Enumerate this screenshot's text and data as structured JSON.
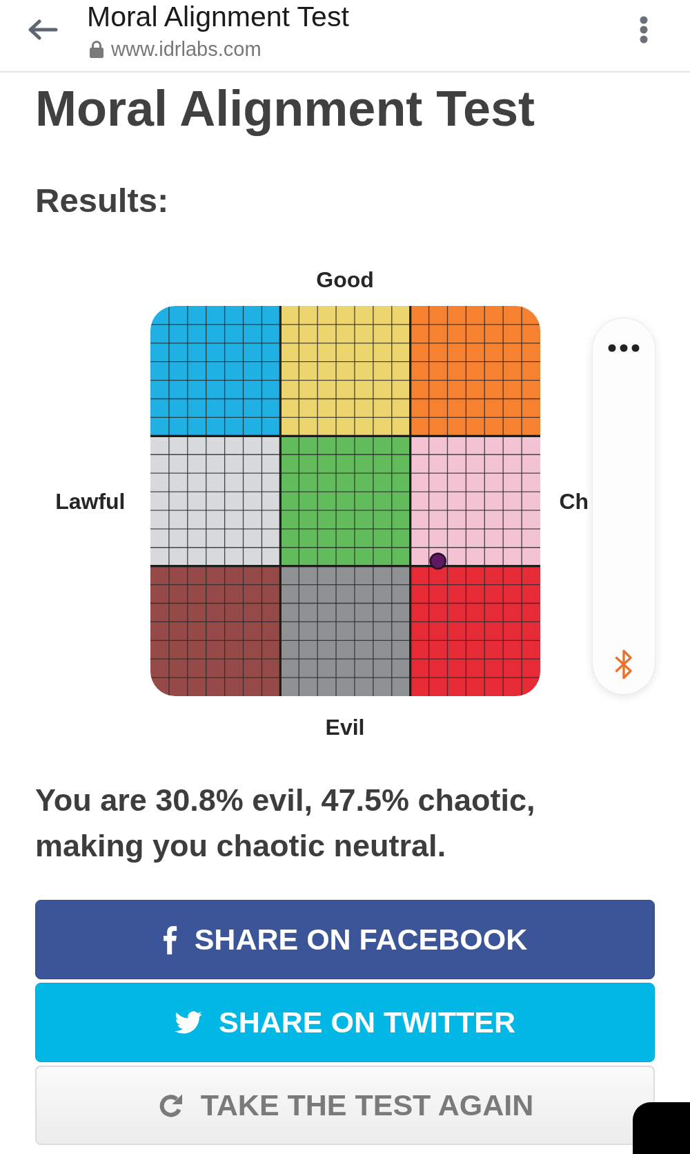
{
  "browser_bar": {
    "title": "Moral Alignment Test",
    "url": "www.idrlabs.com"
  },
  "heading": "Moral Alignment Test",
  "subheading": "Results:",
  "chart": {
    "labels": {
      "top": "Good",
      "left": "Lawful",
      "right": "Ch",
      "bottom": "Evil"
    },
    "regions": [
      {
        "color": "#20b1e4"
      },
      {
        "color": "#ecd56e"
      },
      {
        "color": "#f68131"
      },
      {
        "color": "#d8d9db"
      },
      {
        "color": "#63bc5b"
      },
      {
        "color": "#f3c2d3"
      },
      {
        "color": "#954a48"
      },
      {
        "color": "#8f9193"
      },
      {
        "color": "#e72b36"
      }
    ]
  },
  "result_text": "You are 30.8% evil, 47.5% chaotic, making you chaotic neutral.",
  "buttons": [
    {
      "kind": "facebook",
      "label": "SHARE ON FACEBOOK"
    },
    {
      "kind": "twitter",
      "label": "SHARE ON TWITTER"
    },
    {
      "kind": "retake",
      "label": "TAKE THE TEST AGAIN"
    }
  ]
}
